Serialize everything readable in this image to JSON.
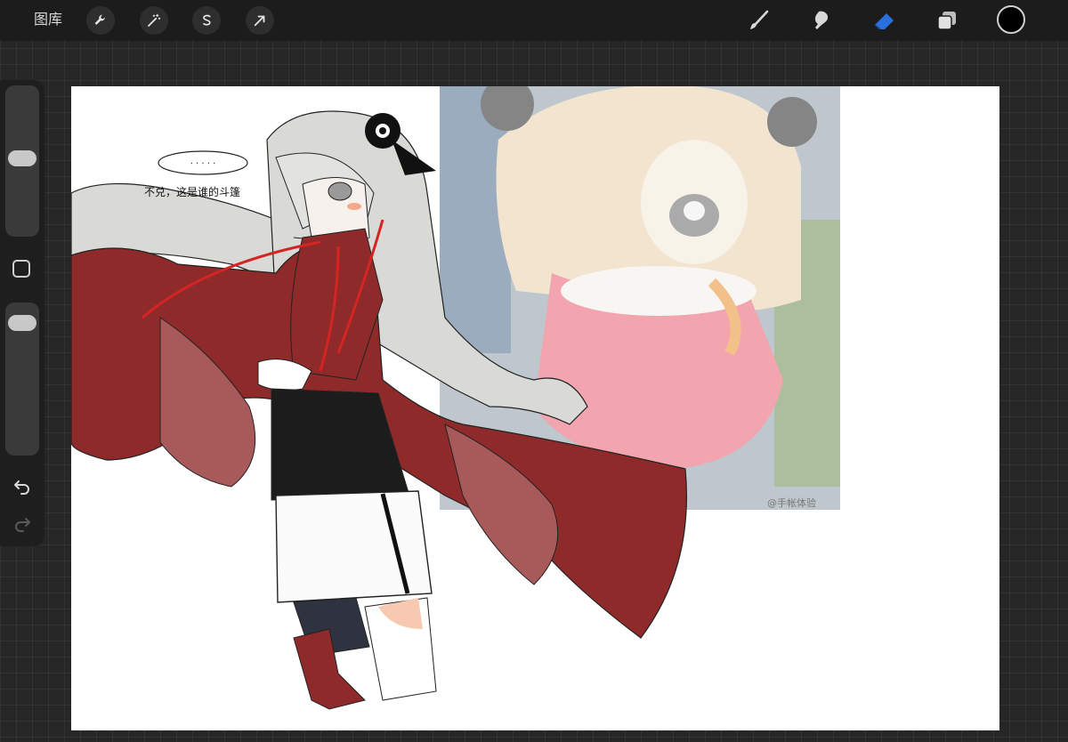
{
  "toolbar": {
    "gallery_label": "图库",
    "left_tools": [
      {
        "name": "actions",
        "icon": "wrench-icon"
      },
      {
        "name": "adjustments",
        "icon": "magic-wand-icon"
      },
      {
        "name": "selection",
        "icon": "selection-s-icon"
      },
      {
        "name": "transform",
        "icon": "arrow-cursor-icon"
      }
    ],
    "right_tools": [
      {
        "name": "brush",
        "icon": "brush-icon"
      },
      {
        "name": "smudge",
        "icon": "smudge-icon"
      },
      {
        "name": "eraser",
        "icon": "eraser-icon",
        "active": true
      },
      {
        "name": "layers",
        "icon": "layers-icon"
      }
    ],
    "active_color": "#000000",
    "eraser_accent": "#2a6fe0"
  },
  "sidebar": {
    "brush_size_level": 0.52,
    "opacity_level": 0.93
  },
  "canvas": {
    "caption": "不兑，这是谁的斗篷",
    "speech_bubble": "· · · · ·",
    "watermark": "@手帐体验",
    "colors": {
      "cloak": "#8f2a2a",
      "cloak_light": "#a85a5a",
      "hair": "#d9d9d6",
      "ribbon": "#d42424"
    }
  }
}
